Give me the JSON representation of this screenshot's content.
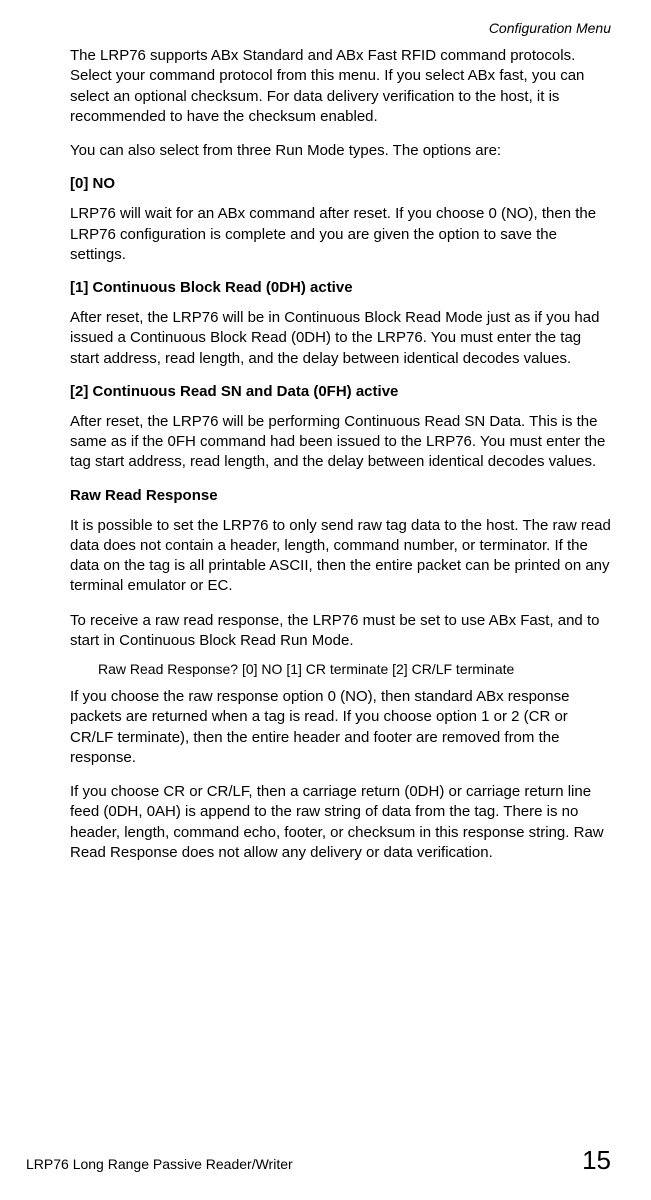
{
  "header": {
    "section": "Configuration Menu"
  },
  "body": {
    "p1": "The LRP76 supports ABx Standard and ABx Fast RFID command protocols. Select your command protocol from this menu. If you select ABx fast, you can select an optional checksum. For data delivery verification to the host, it is recommended to have the checksum enabled.",
    "p2": "You can also select from three Run Mode types. The options are:",
    "h1": "[0] NO",
    "p3": "LRP76 will wait for an ABx command after reset. If you choose 0 (NO), then the LRP76 configuration is complete and you are given the option to save the settings.",
    "h2": "[1] Continuous Block Read (0DH) active",
    "p4": "After reset, the LRP76 will be in Continuous Block Read Mode just as if you had issued a Continuous Block Read (0DH) to the LRP76. You must enter the tag start address, read length, and the delay between identical decodes values.",
    "h3": "[2] Continuous Read SN and Data (0FH) active",
    "p5": "After reset, the LRP76 will be performing Continuous Read SN Data. This is the same as if the 0FH command had been issued to the LRP76. You must enter the tag start address, read length, and the delay between identical decodes values.",
    "h4": "Raw Read Response",
    "p6": "It is possible to set the LRP76 to only send raw tag data to the host. The raw read data does not contain a header, length, command number, or terminator. If the data on the tag is all printable ASCII, then the entire packet can be printed on any terminal emulator or EC.",
    "p7": "To receive a raw read response, the LRP76 must be set to use ABx Fast, and to start in Continuous Block Read Run Mode.",
    "p8": "Raw Read Response? [0] NO [1] CR terminate [2] CR/LF terminate",
    "p9": "If you choose the raw response option 0 (NO), then standard ABx response packets are returned when a tag is read. If you choose option 1 or 2 (CR or CR/LF terminate), then the entire header and footer are removed from the response.",
    "p10": "If you choose CR or CR/LF, then a carriage return (0DH) or carriage return line feed (0DH, 0AH) is append to the raw string of data from the tag. There is no header, length, command echo, footer, or checksum in this response string. Raw Read Response does not allow any delivery or data verification."
  },
  "footer": {
    "left": "LRP76 Long Range Passive Reader/Writer",
    "pagenum": "15"
  }
}
